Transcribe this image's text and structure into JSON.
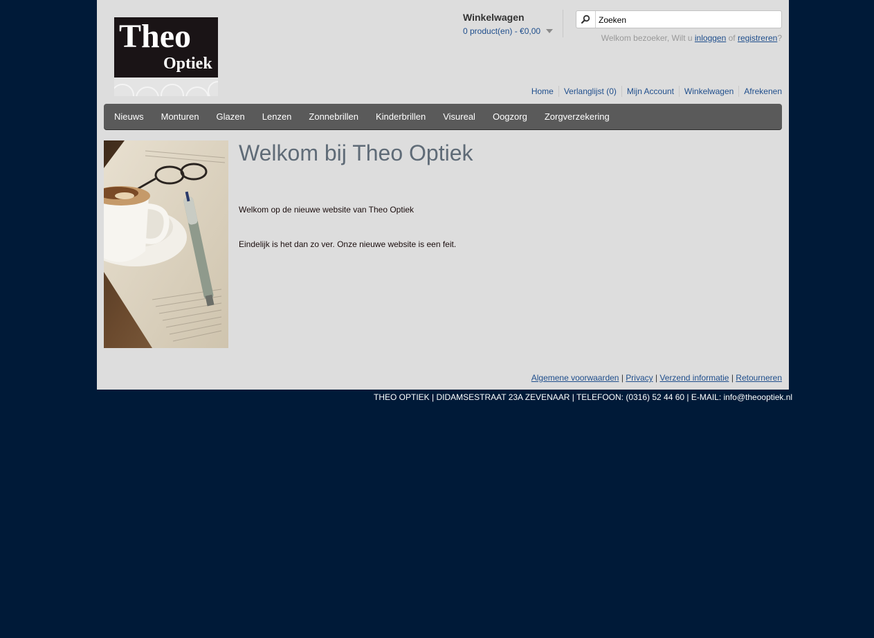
{
  "logo": {
    "line1": "Theo",
    "line2": "Optiek"
  },
  "cart": {
    "title": "Winkelwagen",
    "summary": "0 product(en) - €0,00"
  },
  "search": {
    "value": "Zoeken"
  },
  "welcome": {
    "prefix": "Welkom bezoeker, Wilt u ",
    "login": "inloggen",
    "middle": " of ",
    "register": "registreren",
    "suffix": "?"
  },
  "toplinks": [
    "Home",
    "Verlanglijst (0)",
    "Mijn Account",
    "Winkelwagen",
    "Afrekenen"
  ],
  "menu": [
    "Nieuws",
    "Monturen",
    "Glazen",
    "Lenzen",
    "Zonnebrillen",
    "Kinderbrillen",
    "Visureal",
    "Oogzorg",
    "Zorgverzekering"
  ],
  "content": {
    "title": "Welkom bij Theo Optiek",
    "paragraph1": "Welkom op de nieuwe website van Theo Optiek",
    "paragraph2": "Eindelijk is het dan zo ver. Onze nieuwe website is een feit."
  },
  "footer": {
    "links": [
      "Algemene voorwaarden",
      "Privacy",
      "Verzend informatie",
      "Retourneren"
    ],
    "separator": " | ",
    "address": "THEO OPTIEK | DIDAMSESTRAAT 23A ZEVENAAR | TELEFOON: (0316) 52 44 60 | E-MAIL: info@theooptiek.nl"
  },
  "icons": {
    "search": "search-icon",
    "cart_dropdown": "chevron-down-icon"
  },
  "colors": {
    "background": "#001a38",
    "page": "#dddddd",
    "menu": "#5a5a5a",
    "link": "#1f4e8c",
    "title": "#5f6b77"
  }
}
